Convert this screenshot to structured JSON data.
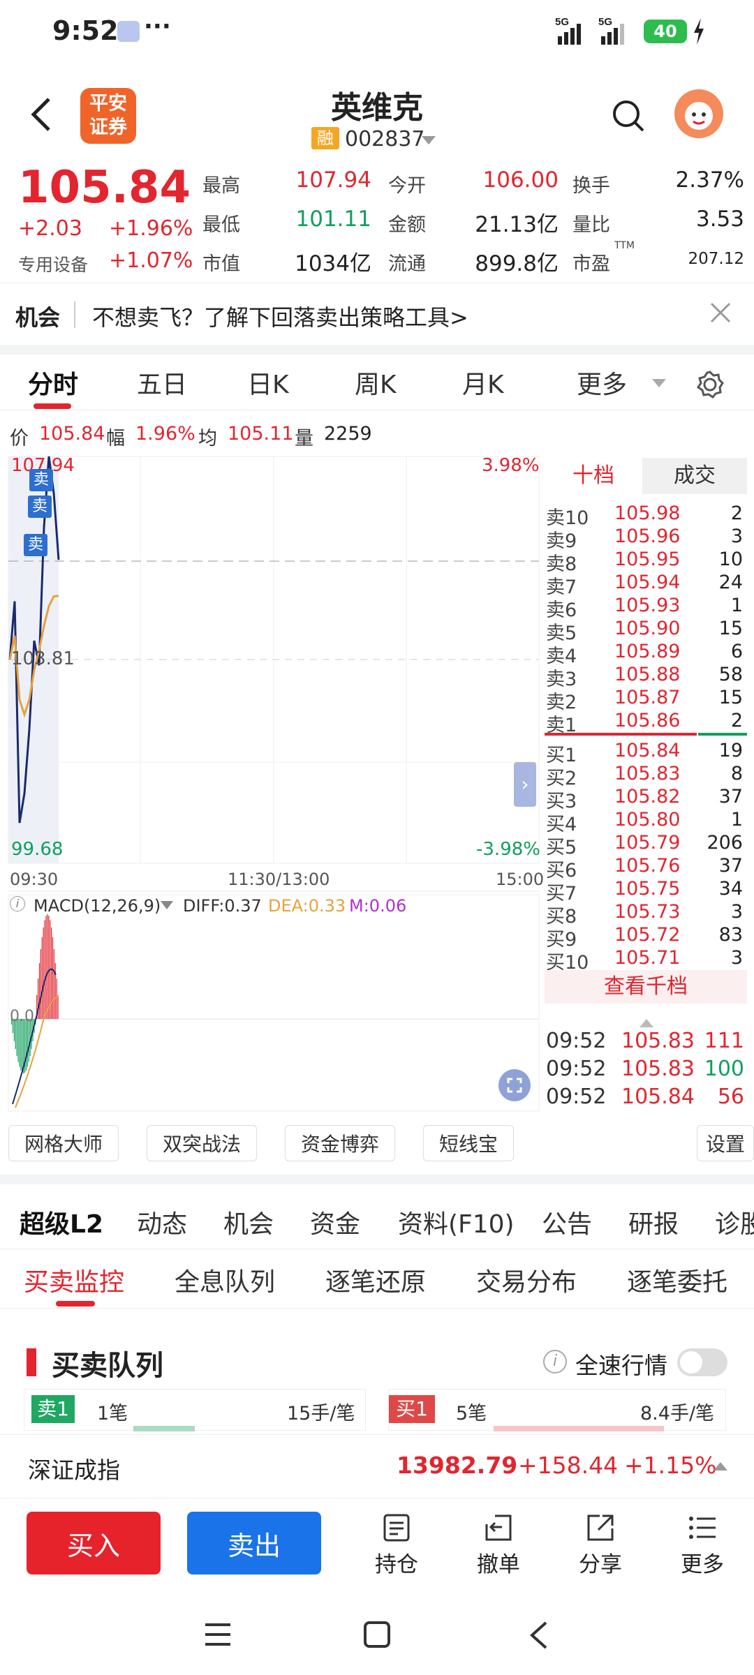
{
  "status": {
    "time": "9:52",
    "dots": "···",
    "battery": "40",
    "sig1": "5G",
    "sig2": "5G"
  },
  "nav": {
    "broker_logo": "平安证券",
    "title": "英维克",
    "rong": "融",
    "code": "002837"
  },
  "quote": {
    "price": "105.84",
    "change": "+2.03",
    "change_pct": "+1.96%",
    "sector": "专用设备",
    "sector_pct": "+1.07%",
    "rows": [
      [
        {
          "label": "最高",
          "value": "107.94",
          "color": "red"
        },
        {
          "label": "今开",
          "value": "106.00",
          "color": "red"
        },
        {
          "label": "换手",
          "value": "2.37%",
          "color": "dark"
        }
      ],
      [
        {
          "label": "最低",
          "value": "101.11",
          "color": "green"
        },
        {
          "label": "金额",
          "value": "21.13亿",
          "color": "dark"
        },
        {
          "label": "量比",
          "value": "3.53",
          "color": "dark"
        }
      ],
      [
        {
          "label": "市值",
          "value": "1034亿",
          "color": "dark"
        },
        {
          "label": "流通",
          "value": "899.8亿",
          "color": "dark"
        },
        {
          "label": "市盈",
          "value": "207.12",
          "color": "dark",
          "sup": "TTM"
        }
      ]
    ]
  },
  "opportunity": {
    "tag": "机会",
    "text": "不想卖飞？了解下回落卖出策略工具>"
  },
  "chart_tabs": [
    "分时",
    "五日",
    "日K",
    "周K",
    "月K",
    "更多"
  ],
  "chart_info": {
    "price_label": "价",
    "price": "105.84",
    "amp_label": "幅",
    "amp": "1.96%",
    "avg_label": "均",
    "avg": "105.11",
    "vol_label": "量",
    "vol": "2259"
  },
  "chart_axis": {
    "high": "107.94",
    "mid": "103.81",
    "low": "99.68",
    "high_pct": "3.98%",
    "low_pct": "-3.98%",
    "t0": "09:30",
    "t1": "11:30/13:00",
    "t2": "15:00"
  },
  "sell_tag": "卖",
  "macd": {
    "label": "MACD(12,26,9)",
    "diff": "DIFF:0.37",
    "dea": "DEA:0.33",
    "m": "M:0.06",
    "zero": "0.0"
  },
  "chart_data": {
    "type": "line",
    "title": "分时",
    "x_range": [
      "09:30",
      "15:00"
    ],
    "ylim": [
      99.68,
      107.94
    ],
    "prev_close": 103.81,
    "series": [
      {
        "name": "价",
        "values": [
          103.81,
          105.0,
          100.5,
          101.1,
          102.4,
          104.2,
          103.7,
          106.5,
          107.94,
          107.2,
          105.84
        ]
      },
      {
        "name": "均",
        "values": [
          103.81,
          104.3,
          103.0,
          102.7,
          103.0,
          103.6,
          104.0,
          104.5,
          104.9,
          105.1,
          105.11
        ]
      }
    ]
  },
  "book": {
    "tab_ten": "十档",
    "tab_deal": "成交",
    "asks": [
      [
        "卖10",
        "105.98",
        "2"
      ],
      [
        "卖9",
        "105.96",
        "3"
      ],
      [
        "卖8",
        "105.95",
        "10"
      ],
      [
        "卖7",
        "105.94",
        "24"
      ],
      [
        "卖6",
        "105.93",
        "1"
      ],
      [
        "卖5",
        "105.90",
        "15"
      ],
      [
        "卖4",
        "105.89",
        "6"
      ],
      [
        "卖3",
        "105.88",
        "58"
      ],
      [
        "卖2",
        "105.87",
        "15"
      ],
      [
        "卖1",
        "105.86",
        "2"
      ]
    ],
    "bids": [
      [
        "买1",
        "105.84",
        "19"
      ],
      [
        "买2",
        "105.83",
        "8"
      ],
      [
        "买3",
        "105.82",
        "37"
      ],
      [
        "买4",
        "105.80",
        "1"
      ],
      [
        "买5",
        "105.79",
        "206"
      ],
      [
        "买6",
        "105.76",
        "37"
      ],
      [
        "买7",
        "105.75",
        "34"
      ],
      [
        "买8",
        "105.73",
        "3"
      ],
      [
        "买9",
        "105.72",
        "83"
      ],
      [
        "买10",
        "105.71",
        "3"
      ]
    ],
    "view_more": "查看千档",
    "trades": [
      [
        "09:52",
        "105.83",
        "111",
        "red"
      ],
      [
        "09:52",
        "105.83",
        "100",
        "green"
      ],
      [
        "09:52",
        "105.84",
        "56",
        "red"
      ]
    ]
  },
  "tools": [
    "网格大师",
    "双突战法",
    "资金博弈",
    "短线宝"
  ],
  "settings": "设置",
  "tabs2": [
    "超级L2",
    "动态",
    "机会",
    "资金",
    "资料(F10)",
    "公告",
    "研报",
    "诊股"
  ],
  "tabs3": [
    "买卖监控",
    "全息队列",
    "逐笔还原",
    "交易分布",
    "逐笔委托"
  ],
  "queue": {
    "title": "买卖队列",
    "fullspeed": "全速行情",
    "sell_tag": "卖1",
    "sell_count": "1笔",
    "sell_avg": "15手/笔",
    "buy_tag": "买1",
    "buy_count": "5笔",
    "buy_avg": "8.4手/笔"
  },
  "index": {
    "name": "深证成指",
    "value": "13982.79",
    "change": "+158.44",
    "pct": "+1.15%"
  },
  "bottom": {
    "buy": "买入",
    "sell": "卖出",
    "hold": "持仓",
    "cancel": "撤单",
    "share": "分享",
    "more": "更多"
  }
}
